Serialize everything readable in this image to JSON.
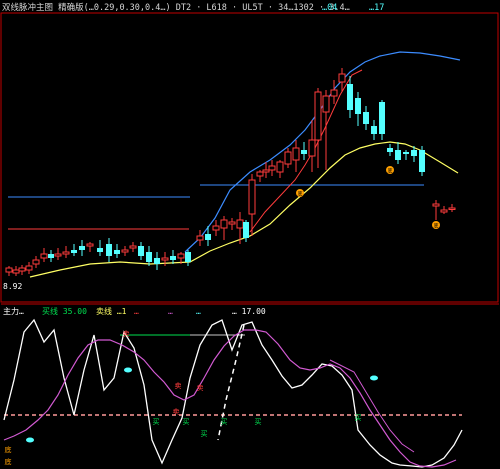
{
  "colors": {
    "background": "#000000",
    "frame": "#c00000",
    "up_candle": "#ff3c3c",
    "down_candle": "#54ffff",
    "upper_band": "#3c8cff",
    "lower_band": "#ffff64",
    "mid_line": "#ffffff",
    "osc_white": "#ffffff",
    "osc_purple": "#d25ad2",
    "dashed_level": "#ff9a9a",
    "green_mark": "#00e050",
    "marker_orange": "#ffa000"
  },
  "main_panel": {
    "header_text": "双线脉冲主图 精确版(…0.29,0.30,0.4…)  DT2 · L618 · UL5T · 34…1302 · 3.4…",
    "header_right_items": [
      "…04",
      "…17"
    ],
    "price_label": "8.92"
  },
  "indicator_panel": {
    "header_items": [
      {
        "text": "主力…",
        "color": "#ffffff",
        "name": "indicator-name"
      },
      {
        "text": "买线 35.00",
        "color": "#00e050",
        "name": "buy-line-value"
      },
      {
        "text": "卖线 …1",
        "color": "#ffff64",
        "name": "sell-line-value"
      },
      {
        "text": "…",
        "color": "#ff3c3c",
        "name": "signal-a-value"
      },
      {
        "text": "…",
        "color": "#d25ad2",
        "name": "signal-b-value"
      },
      {
        "text": "…",
        "color": "#54ffff",
        "name": "signal-c-value"
      },
      {
        "text": "… 17.00",
        "color": "#ffffff",
        "name": "threshold-value"
      }
    ],
    "signal_labels": {
      "sell": "卖",
      "buy": "买",
      "bottom": "底"
    }
  }
}
